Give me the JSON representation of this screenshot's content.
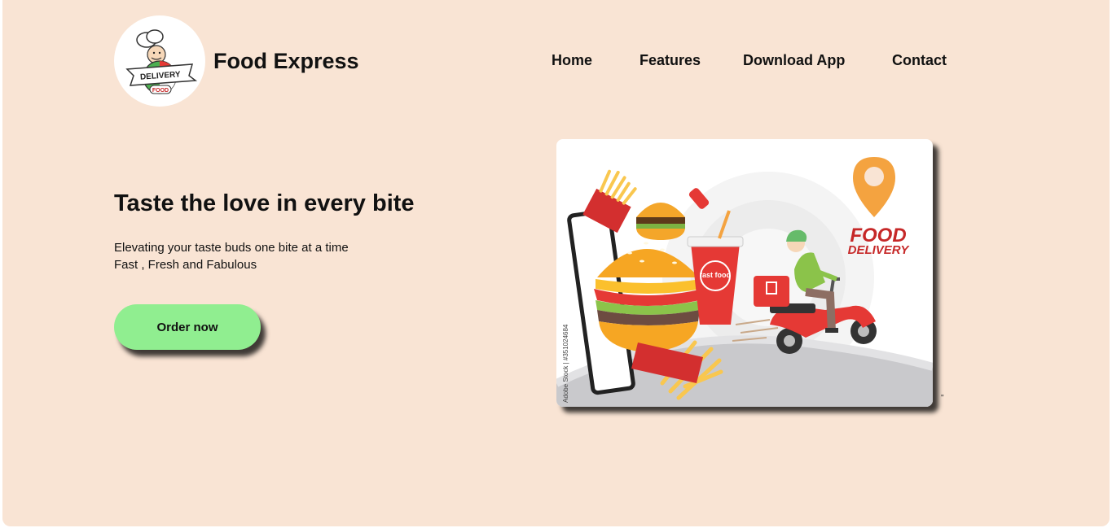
{
  "brand": {
    "title": "Food Express",
    "logo_text_top": "DELIVERY",
    "logo_text_bottom": "FOOD"
  },
  "nav": {
    "items": [
      "Home",
      "Features",
      "Download App",
      "Contact"
    ]
  },
  "hero": {
    "title": "Taste the love in every bite",
    "subtitle_line1": "Elevating your taste buds one bite at a time",
    "subtitle_line2": "Fast , Fresh and Fabulous",
    "cta_label": "Order now",
    "cta_color": "#90ee90"
  },
  "illustration": {
    "heading_line1": "FOOD",
    "heading_line2": "DELIVERY",
    "cup_label": "fast food",
    "watermark": "Adobe Stock | #351024684",
    "trailing_mark": "\""
  },
  "colors": {
    "page_background": "#f9e4d4",
    "accent_red": "#e53935",
    "heading_red": "#c62828",
    "pin_orange": "#f4a340"
  }
}
